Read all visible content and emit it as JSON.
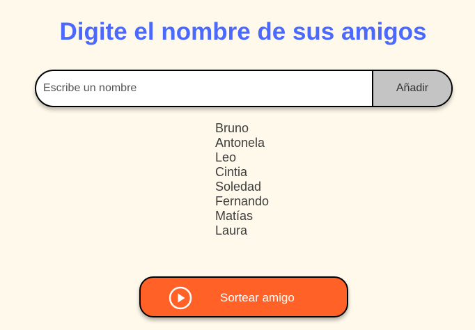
{
  "header": {
    "title": "Digite el nombre de sus amigos"
  },
  "input": {
    "placeholder": "Escribe un nombre",
    "value": ""
  },
  "add_button": {
    "label": "Añadir"
  },
  "friends": [
    "Bruno",
    "Antonela",
    "Leo",
    "Cintia",
    "Soledad",
    "Fernando",
    "Matías",
    "Laura"
  ],
  "draw_button": {
    "label": "Sortear amigo",
    "icon": "play-circle-icon"
  },
  "colors": {
    "background": "#fff9eb",
    "title": "#4b69fd",
    "add_button_bg": "#c4c4c4",
    "draw_button_bg": "#ff6127"
  }
}
